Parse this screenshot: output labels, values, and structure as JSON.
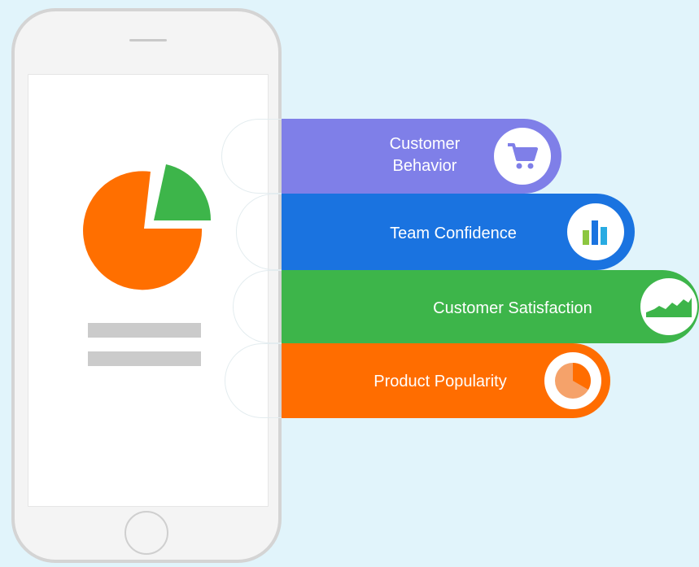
{
  "features": [
    {
      "label_line1": "Customer",
      "label_line2": "Behavior",
      "color": "#7f7fe8",
      "icon": "shopping-cart-icon"
    },
    {
      "label": "Team Confidence",
      "color": "#1a73e0",
      "icon": "bar-chart-icon"
    },
    {
      "label": "Customer Satisfaction",
      "color": "#3db54a",
      "icon": "area-chart-icon"
    },
    {
      "label": "Product Popularity",
      "color": "#ff6d00",
      "icon": "pie-chart-icon"
    }
  ],
  "pie_colors": {
    "large": "#ff6f00",
    "small": "#3db54a"
  }
}
